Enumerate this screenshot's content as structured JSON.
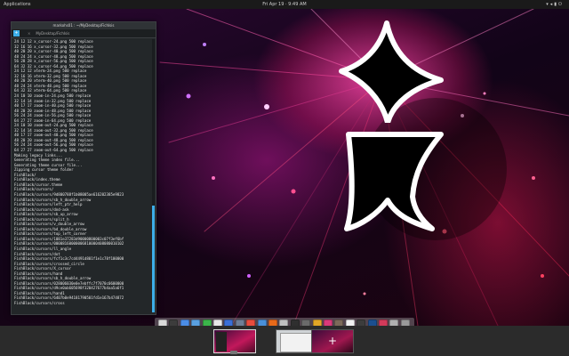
{
  "topbar": {
    "left_label": "Applications",
    "clock": "Fri Apr 19 · 9:49 AM",
    "tray_icons": [
      "network-icon",
      "volume-icon",
      "battery-icon",
      "power-icon"
    ]
  },
  "terminal": {
    "title": "markohs01 : ~/MyDesktop/FichIsis",
    "tab_label": "MyDesktop/FichIsis",
    "lines": [
      "24 12 12 x_cursor-24.png 500 replace",
      "32 16 16 x_cursor-32.png 500 replace",
      "40 20 20 x_cursor-40.png 500 replace",
      "48 24 24 x_cursor-48.png 500 replace",
      "56 28 28 x_cursor-56.png 500 replace",
      "64 32 32 x_cursor-64.png 500 replace",
      "24 12 12 xterm-24.png 500 replace",
      "32 16 16 xterm-32.png 500 replace",
      "40 20 20 xterm-40.png 500 replace",
      "48 24 24 xterm-48.png 500 replace",
      "64 32 32 xterm-64.png 500 replace",
      "24 10 10 zoom-in-24.png 500 replace",
      "32 14 14 zoom-in-32.png 500 replace",
      "40 17 17 zoom-in-40.png 500 replace",
      "48 20 20 zoom-in-48.png 500 replace",
      "56 24 24 zoom-in-56.png 500 replace",
      "64 27 27 zoom-in-64.png 500 replace",
      "24 10 10 zoom-out-24.png 500 replace",
      "32 14 14 zoom-out-32.png 500 replace",
      "40 17 17 zoom-out-40.png 500 replace",
      "48 20 20 zoom-out-48.png 500 replace",
      "56 24 24 zoom-out-56.png 500 replace",
      "64 27 27 zoom-out-64.png 500 replace",
      "Making legacy links...",
      "Generating theme index file...",
      "Generating theme cursor file...",
      "Zipping cursor theme folder",
      "FishBlack/",
      "FishBlack/index.theme",
      "FishBlack/cursor.theme",
      "FishBlack/cursors/",
      "FishBlack/cursors/9d800788f1b08005ae616202385e9823",
      "FishBlack/cursors/sb_h_double_arrow",
      "FishBlack/cursors/left_ptr_help",
      "FishBlack/cursors/dnd-ask",
      "FishBlack/cursors/sb_up_arrow",
      "FishBlack/cursors/split_h",
      "FishBlack/cursors/v_double_arrow",
      "FishBlack/cursors/bd_double_arrow",
      "FishBlack/cursors/top_left_corner",
      "FishBlack/cursors/1081e37283d90000800003c07f3ef6bf",
      "FishBlack/cursors/00008160000006810000408080010102",
      "FishBlack/cursors/ll_angle",
      "FishBlack/cursors/dot",
      "FishBlack/cursors/fcf1c3c7cd4491d801f1e1c78f100000",
      "FishBlack/cursors/crossed_circle",
      "FishBlack/cursors/X_cursor",
      "FishBlack/cursors/hand",
      "FishBlack/cursors/sb_h_double_arrow",
      "FishBlack/cursors/028006030e0e7ebffc7f7070c0600000",
      "FishBlack/cursors/d9ce0ab605698f320427677b4aa5a6f1",
      "FishBlack/cursors/hand1",
      "FishBlack/cursors/6407b0e94181790501fd1e167b474872",
      "FishBlack/cursors/cross"
    ]
  },
  "dock": {
    "icons": [
      {
        "name": "files-icon",
        "color": "#d9d9d9"
      },
      {
        "name": "terminal-icon",
        "color": "#3c3c3c"
      },
      {
        "name": "software-center-icon",
        "color": "#4b8de6"
      },
      {
        "name": "browser-icon",
        "color": "#5aa0e0"
      },
      {
        "name": "mail-icon",
        "color": "#3bb54a"
      },
      {
        "name": "calendar-icon",
        "color": "#e8e8e8"
      },
      {
        "name": "music-icon",
        "color": "#3b6fd6"
      },
      {
        "name": "photos-icon",
        "color": "#6f7e96"
      },
      {
        "name": "video-icon",
        "color": "#e84c3d"
      },
      {
        "name": "chat-icon",
        "color": "#4a90d9"
      },
      {
        "name": "game-icon",
        "color": "#e86a1a"
      },
      {
        "name": "text-editor-icon",
        "color": "#c0c0c0"
      },
      {
        "name": "code-editor-icon",
        "color": "#2f2f2f"
      },
      {
        "name": "settings-icon",
        "color": "#6a6a6a"
      },
      {
        "name": "maps-icon",
        "color": "#e2a726"
      },
      {
        "name": "store-icon",
        "color": "#d93a7a"
      },
      {
        "name": "gimp-icon",
        "color": "#7c6a5a"
      },
      {
        "name": "libreoffice-icon",
        "color": "#f1f1f1"
      },
      {
        "name": "notes-icon",
        "color": "#3c3c3c"
      },
      {
        "name": "tasks-icon",
        "color": "#1b4f8f"
      },
      {
        "name": "paint-icon",
        "color": "#d33a5a"
      },
      {
        "name": "system-monitor-icon",
        "color": "#b0b0b0"
      },
      {
        "name": "trash-icon",
        "color": "#9a9a9a"
      }
    ]
  },
  "overview": {
    "new_workspace_label": "+"
  },
  "colors": {
    "accent": "#3daee9",
    "cursor_fill": "#000000",
    "cursor_stroke": "#ffffff"
  }
}
